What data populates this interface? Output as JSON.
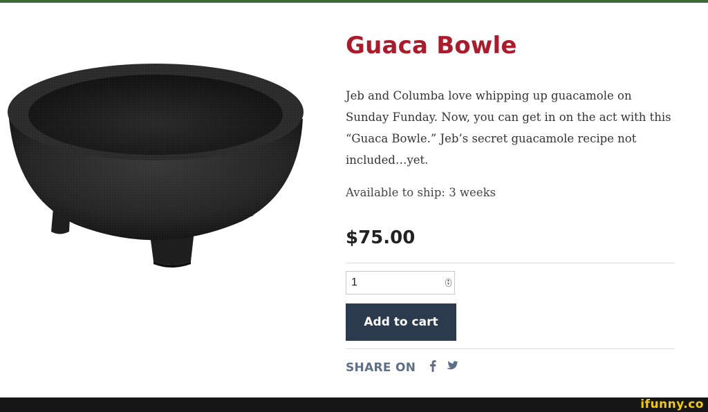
{
  "product": {
    "title": "Guaca Bowle",
    "description": "Jeb and Columba love whipping up guacamole on Sunday Funday. Now, you can get in on the act with this “Guaca Bowle.” Jeb’s secret guacamole recipe not included…yet.",
    "shipping": "Available to ship: 3 weeks",
    "price": "$75.00",
    "quantity": "1",
    "add_to_cart_label": "Add to cart"
  },
  "share": {
    "label": "SHARE ON",
    "icons": [
      "facebook-icon",
      "twitter-icon"
    ],
    "icon_color": "#5c6f86"
  },
  "colors": {
    "title": "#ad1a2a",
    "button": "#2b3a4d",
    "watermark": "#f2cc00"
  },
  "watermark": {
    "text": "ifunny.co"
  }
}
